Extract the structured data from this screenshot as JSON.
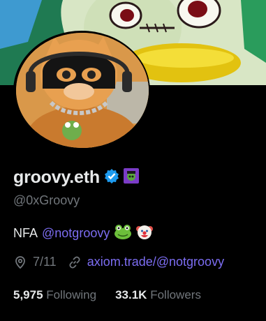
{
  "profile": {
    "display_name": "groovy.eth",
    "handle": "@0xGroovy",
    "verified": true,
    "bio_prefix": "NFA",
    "bio_mention": "@notgroovy",
    "bio_emojis": [
      "frog-emoji",
      "clown-emoji"
    ],
    "location": "7/11",
    "link": "axiom.trade/@notgroovy",
    "following_count": "5,975",
    "following_label": "Following",
    "followers_count": "33.1K",
    "followers_label": "Followers"
  },
  "colors": {
    "background": "#000000",
    "text": "#e7e9ea",
    "muted": "#71767b",
    "accent": "#7c6df2",
    "verified": "#1d9bf0"
  }
}
